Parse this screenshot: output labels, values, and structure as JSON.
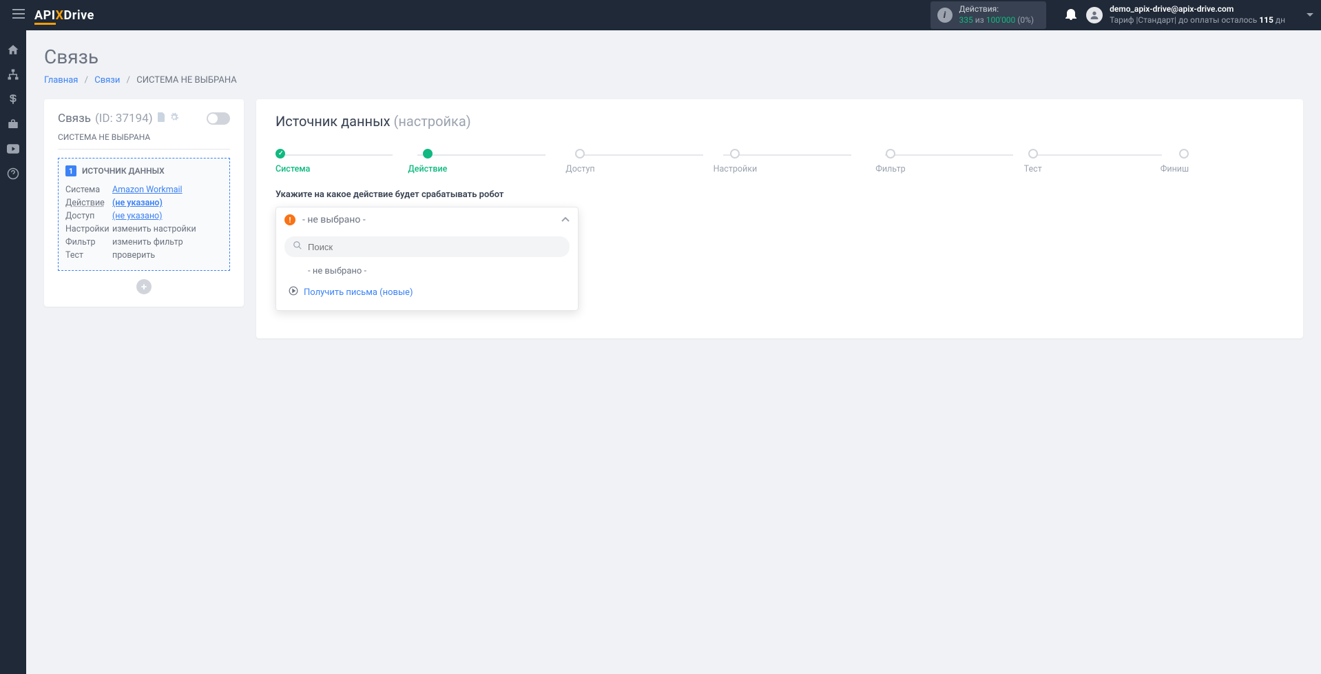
{
  "logo": {
    "p1": "API",
    "p2": "X",
    "p3": "Drive"
  },
  "header": {
    "actions_label": "Действия:",
    "actions_used": "335",
    "actions_of": " из ",
    "actions_total": "100'000",
    "actions_pct": " (0%)",
    "email": "demo_apix-drive@apix-drive.com",
    "tariff_pre": "Тариф |Стандарт| до оплаты осталось ",
    "tariff_days": "115",
    "tariff_suf": " дн"
  },
  "page": {
    "title": "Связь",
    "crumb_home": "Главная",
    "crumb_links": "Связи",
    "crumb_current": "СИСТЕМА НЕ ВЫБРАНА"
  },
  "left": {
    "title": "Связь",
    "id_label": "(ID: 37194)",
    "sub": "СИСТЕМА НЕ ВЫБРАНА",
    "badge": "1",
    "head": "ИСТОЧНИК ДАННЫХ",
    "rows": {
      "system_l": "Система",
      "system_v": "Amazon Workmail",
      "action_l": "Действие",
      "action_v": "(не указано)",
      "access_l": "Доступ",
      "access_v": "(не указано)",
      "settings_l": "Настройки",
      "settings_v": "изменить настройки",
      "filter_l": "Фильтр",
      "filter_v": "изменить фильтр",
      "test_l": "Тест",
      "test_v": "проверить"
    }
  },
  "right": {
    "title": "Источник данных",
    "title_sub": "(настройка)",
    "steps": [
      "Система",
      "Действие",
      "Доступ",
      "Настройки",
      "Фильтр",
      "Тест",
      "Финиш"
    ],
    "field_label": "Укажите на какое действие будет срабатывать робот",
    "dd_selected": "- не выбрано -",
    "search_ph": "Поиск",
    "opt_none": "- не выбрано -",
    "opt_get": "Получить письма (новые)"
  }
}
